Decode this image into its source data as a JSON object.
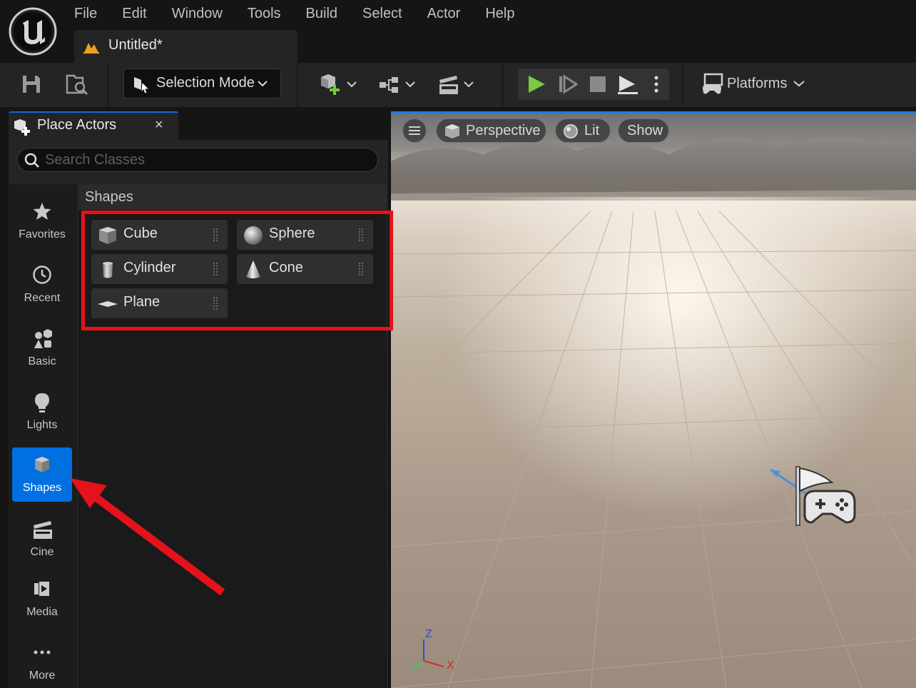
{
  "menu": [
    "File",
    "Edit",
    "Window",
    "Tools",
    "Build",
    "Select",
    "Actor",
    "Help"
  ],
  "document_tab": {
    "title": "Untitled*"
  },
  "toolbar": {
    "selection_mode": "Selection Mode",
    "platforms": "Platforms"
  },
  "panel": {
    "title": "Place Actors",
    "close_glyph": "×",
    "search_placeholder": "Search Classes",
    "categories": [
      {
        "label": "Favorites",
        "icon": "star-icon"
      },
      {
        "label": "Recent",
        "icon": "clock-icon"
      },
      {
        "label": "Basic",
        "icon": "basic-shapes-icon"
      },
      {
        "label": "Lights",
        "icon": "lightbulb-icon"
      },
      {
        "label": "Shapes",
        "icon": "cube-icon",
        "active": true
      },
      {
        "label": "Cine",
        "icon": "clapperboard-icon"
      },
      {
        "label": "Media",
        "icon": "media-play-icon"
      },
      {
        "label": "More",
        "icon": "ellipsis-icon"
      }
    ],
    "section_title": "Shapes",
    "shapes": [
      "Cube",
      "Sphere",
      "Cylinder",
      "Cone",
      "Plane"
    ]
  },
  "viewport": {
    "perspective": "Perspective",
    "lit": "Lit",
    "show": "Show",
    "axis_z": "Z",
    "axis_x": "X"
  },
  "colors": {
    "accent_blue": "#0070e0",
    "annotation_red": "#e3121b",
    "play_green": "#7ac943"
  }
}
